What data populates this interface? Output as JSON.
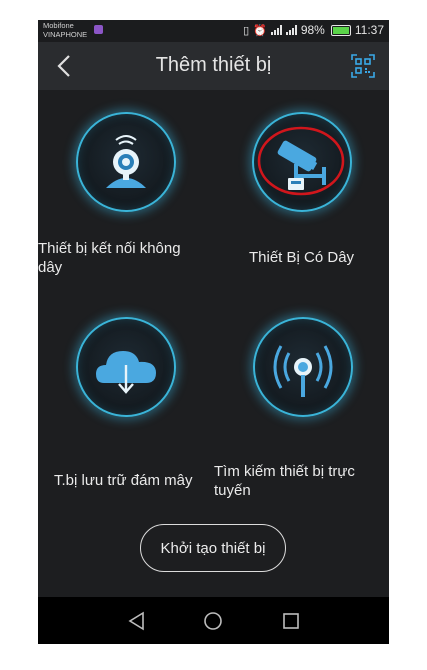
{
  "status_bar": {
    "carrier_1": "Mobifone",
    "carrier_2": "VINAPHONE",
    "battery_percent": "98%",
    "battery_level": 0.98,
    "time": "11:37",
    "icons": [
      "viber-icon",
      "vibrate-icon",
      "alarm-icon",
      "signal-icon",
      "signal-h-icon",
      "battery-icon"
    ]
  },
  "header": {
    "title": "Thêm thiết bị",
    "back_icon": "chevron-left-icon",
    "qr_icon": "qr-scan-icon"
  },
  "tiles": [
    {
      "label": "Thiết bị kết nối không dây",
      "icon": "wireless-camera-icon"
    },
    {
      "label": "Thiết Bị Có Dây",
      "icon": "wired-camera-icon",
      "highlighted": true
    },
    {
      "label": "T.bị lưu trữ đám mây",
      "icon": "cloud-download-icon"
    },
    {
      "label": "Tìm kiếm thiết bị trực tuyến",
      "icon": "broadcast-icon"
    }
  ],
  "init_button": {
    "label": "Khởi tạo thiết bị"
  },
  "nav_bar": {
    "icons": [
      "back-triangle-icon",
      "home-circle-icon",
      "recents-square-icon"
    ]
  },
  "colors": {
    "background": "#1d1e20",
    "accent": "#3ab4d8",
    "icon_blue": "#4aa8e0",
    "highlight_ring": "#d0161c"
  }
}
